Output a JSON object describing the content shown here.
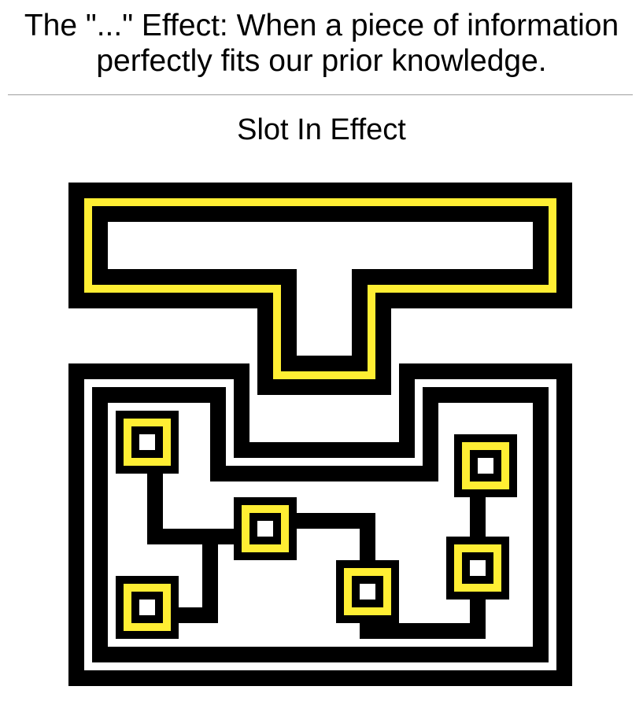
{
  "header": {
    "title_line1": "The \"...\" Effect: When a piece of information",
    "title_line2": "perfectly fits our prior knowledge."
  },
  "subtitle": "Slot In Effect",
  "colors": {
    "ink": "#000000",
    "highlight": "#ffee33",
    "background": "#ffffff",
    "divider": "#9e9e9e"
  }
}
